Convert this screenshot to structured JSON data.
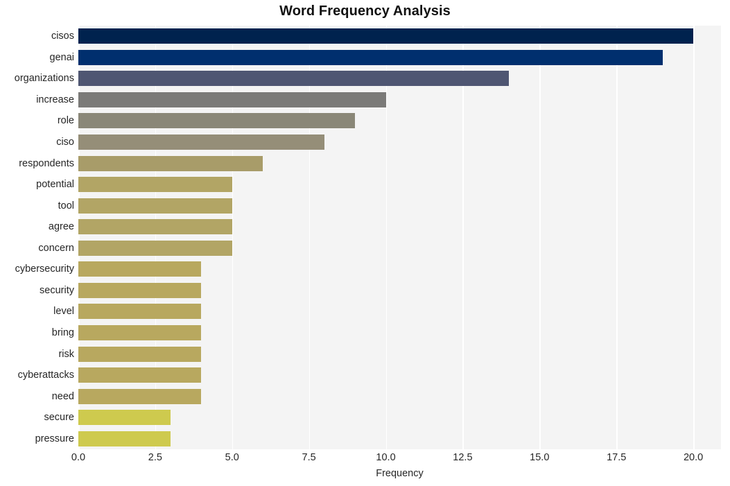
{
  "chart_data": {
    "type": "bar",
    "orientation": "horizontal",
    "title": "Word Frequency Analysis",
    "xlabel": "Frequency",
    "ylabel": "",
    "xlim": [
      0.0,
      20.9
    ],
    "xticks": [
      "0.0",
      "2.5",
      "5.0",
      "7.5",
      "10.0",
      "12.5",
      "15.0",
      "17.5",
      "20.0"
    ],
    "xtick_values": [
      0.0,
      2.5,
      5.0,
      7.5,
      10.0,
      12.5,
      15.0,
      17.5,
      20.0
    ],
    "grid": "vertical-white-on-gray",
    "legend": "none",
    "categories": [
      "cisos",
      "genai",
      "organizations",
      "increase",
      "role",
      "ciso",
      "respondents",
      "potential",
      "tool",
      "agree",
      "concern",
      "cybersecurity",
      "security",
      "level",
      "bring",
      "risk",
      "cyberattacks",
      "need",
      "secure",
      "pressure"
    ],
    "values": [
      20,
      19,
      14,
      10,
      9,
      8,
      6,
      5,
      5,
      5,
      5,
      4,
      4,
      4,
      4,
      4,
      4,
      4,
      3,
      3
    ],
    "bar_colors": [
      "#00224e",
      "#002f6e",
      "#4f5672",
      "#7b7a78",
      "#8a8778",
      "#958e78",
      "#a89c69",
      "#b2a565",
      "#b2a565",
      "#b2a565",
      "#b2a565",
      "#b8a85f",
      "#b8a85f",
      "#b8a85f",
      "#b8a85f",
      "#b8a85f",
      "#b8a85f",
      "#b8a85f",
      "#ceca4e",
      "#ceca4e"
    ],
    "plot_background": "#f4f4f4",
    "gridline_color": "#ffffff",
    "figure_background": "#ffffff",
    "text_color": "#262626"
  }
}
